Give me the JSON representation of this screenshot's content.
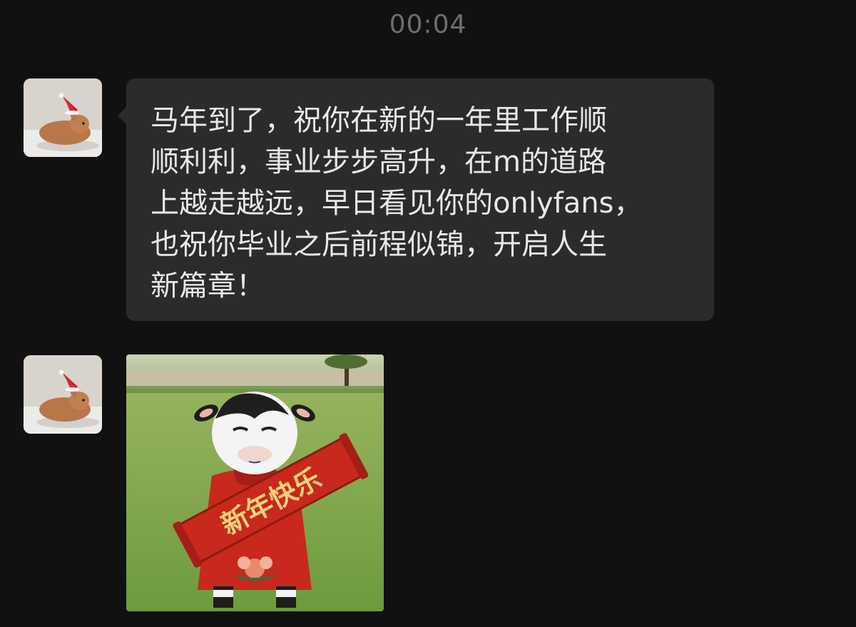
{
  "chat": {
    "timestamp": "00:04",
    "messages": [
      {
        "type": "text",
        "sender_avatar_icon": "bunny-with-santa-hat-avatar",
        "text": "马年到了，祝你在新的一年里工作顺\n顺利利，事业步步高升，在m的道路\n上越走越远，早日看见你的onlyfans，\n也祝你毕业之后前程似锦，开启人生\n新篇章！"
      },
      {
        "type": "sticker",
        "sender_avatar_icon": "bunny-with-santa-hat-avatar",
        "sticker_icon": "cow-holding-banner-sticker",
        "banner_text": "新年快乐"
      }
    ]
  },
  "colors": {
    "background": "#111111",
    "bubble": "#2b2b2b",
    "timestamp": "#6e6e6e",
    "banner_red": "#c8281e",
    "banner_gold": "#f5d27a"
  }
}
